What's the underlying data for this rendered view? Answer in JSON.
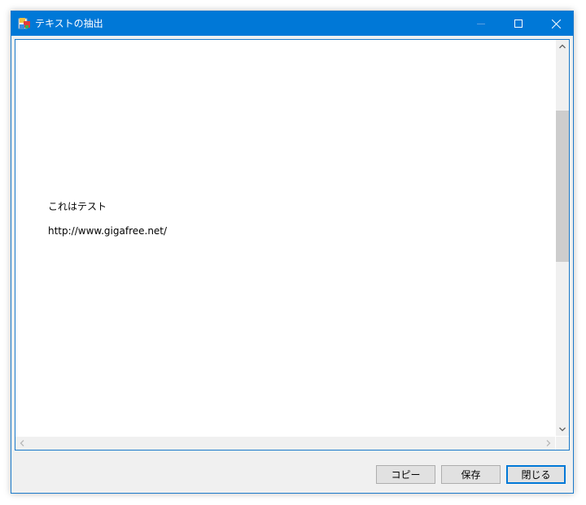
{
  "window": {
    "title": "テキストの抽出"
  },
  "content": {
    "lines": [
      "これはテスト",
      "http://www.gigafree.net/"
    ]
  },
  "buttons": {
    "copy": "コピー",
    "save": "保存",
    "close": "閉じる"
  },
  "colors": {
    "titlebar": "#0078d7",
    "accent_border": "#1979ca",
    "dialog_bg": "#f0f0f0"
  }
}
